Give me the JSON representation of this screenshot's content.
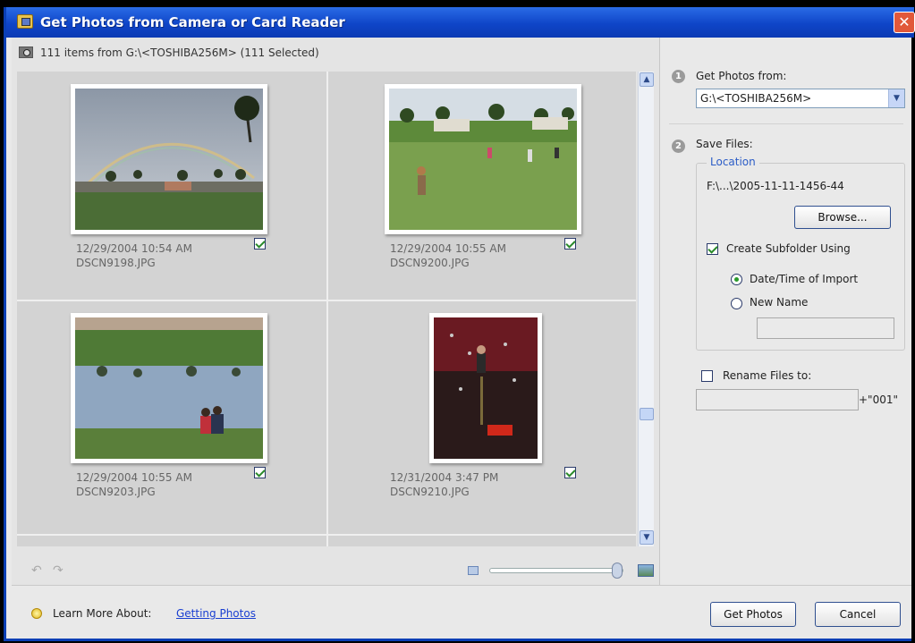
{
  "window": {
    "title": "Get Photos from Camera or Card Reader",
    "close_label": "✕"
  },
  "source_bar": {
    "text": "111 items from G:\\<TOSHIBA256M> (111 Selected)"
  },
  "photos": [
    {
      "date": "12/29/2004 10:54 AM",
      "file": "DSCN9198.JPG",
      "checked": true
    },
    {
      "date": "12/29/2004 10:55 AM",
      "file": "DSCN9200.JPG",
      "checked": true
    },
    {
      "date": "12/29/2004 10:55 AM",
      "file": "DSCN9203.JPG",
      "checked": true
    },
    {
      "date": "12/31/2004 3:47 PM",
      "file": "DSCN9210.JPG",
      "checked": true
    }
  ],
  "zoom": {
    "level": 0.95
  },
  "get_photos_from": {
    "step": "1",
    "label": "Get Photos from:",
    "value": "G:\\<TOSHIBA256M>"
  },
  "save_files": {
    "step": "2",
    "label": "Save Files:",
    "location_legend": "Location",
    "path": "F:\\...\\2005-11-11-1456-44",
    "browse_label": "Browse...",
    "subfolder_label": "Create Subfolder Using",
    "subfolder_checked": true,
    "option_date": "Date/Time of Import",
    "option_name": "New Name",
    "new_name_value": ""
  },
  "rename": {
    "label": "Rename Files to:",
    "checked": false,
    "value": "",
    "suffix": "+\"001\""
  },
  "footer": {
    "learn_more": "Learn More About:",
    "link": "Getting Photos",
    "get_photos_label": "Get Photos",
    "cancel_label": "Cancel"
  }
}
